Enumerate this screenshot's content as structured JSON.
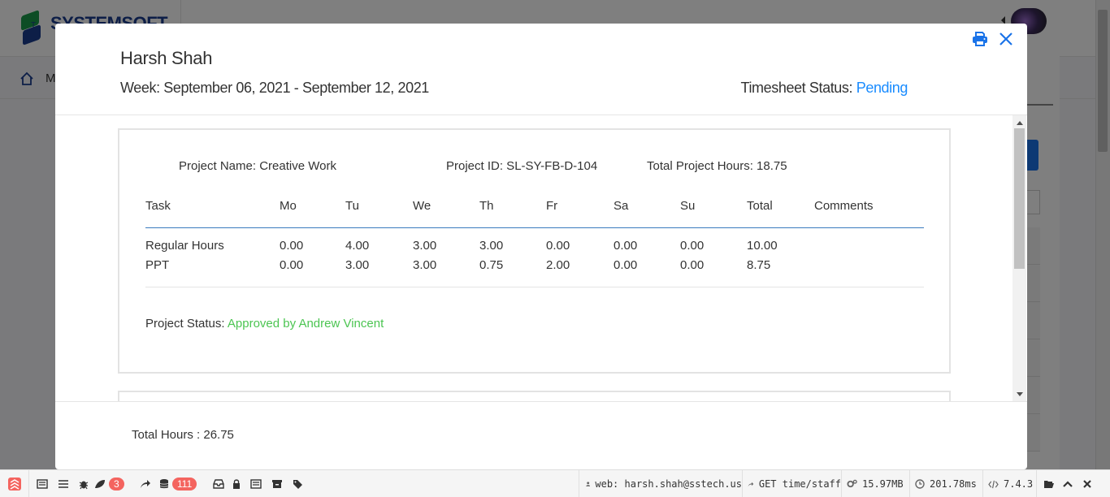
{
  "background": {
    "logo_text": "SYSTEMSOFT",
    "logo_sub": "T",
    "nav_label": "M"
  },
  "modal": {
    "employee_name": "Harsh Shah",
    "week_range": "Week: September 06, 2021 - September 12, 2021",
    "status_label": "Timesheet Status:",
    "status_value": "Pending",
    "project": {
      "name": "Project Name: Creative Work",
      "id": "Project ID: SL-SY-FB-D-104",
      "total_hours": "Total Project Hours: 18.75",
      "columns": [
        "Task",
        "Mo",
        "Tu",
        "We",
        "Th",
        "Fr",
        "Sa",
        "Su",
        "Total",
        "Comments"
      ],
      "rows": [
        {
          "task": "Regular Hours",
          "mo": "0.00",
          "tu": "4.00",
          "we": "3.00",
          "th": "3.00",
          "fr": "0.00",
          "sa": "0.00",
          "su": "0.00",
          "total": "10.00",
          "comments": ""
        },
        {
          "task": "PPT",
          "mo": "0.00",
          "tu": "3.00",
          "we": "3.00",
          "th": "0.75",
          "fr": "2.00",
          "sa": "0.00",
          "su": "0.00",
          "total": "8.75",
          "comments": ""
        }
      ],
      "status_label": "Project Status:",
      "status_value": "Approved by Andrew Vincent"
    },
    "total_hours": "Total Hours : 26.75"
  },
  "debugbar": {
    "messages_count": "3",
    "queries_count": "111",
    "user": "web: harsh.shah@sstech.us",
    "route": "GET time/staff",
    "memory": "15.97MB",
    "duration": "201.78ms",
    "php_version": "7.4.3"
  }
}
